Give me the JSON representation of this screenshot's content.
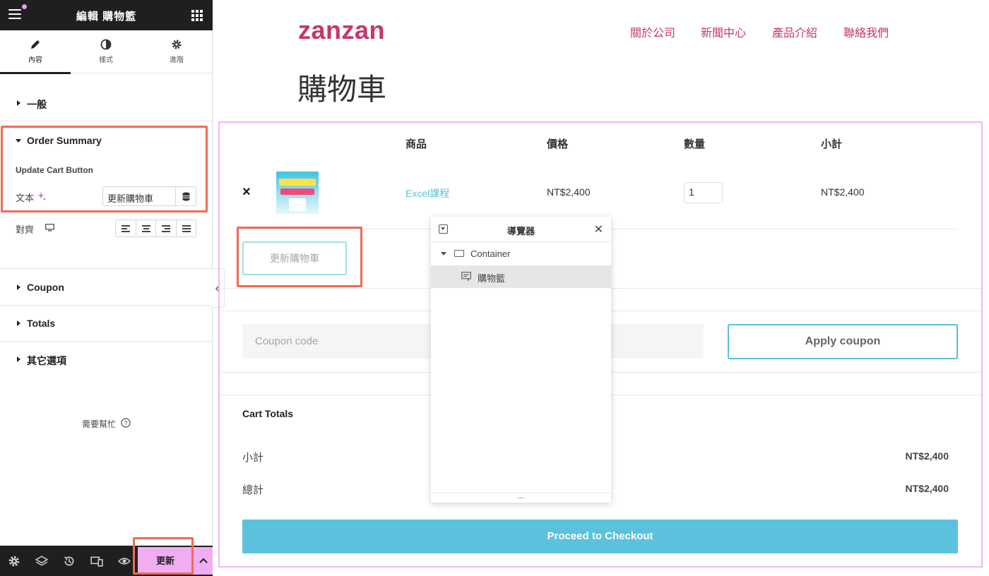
{
  "panel": {
    "title": "編輯 購物籃",
    "tabs": [
      {
        "label": "內容",
        "icon": "pencil-icon"
      },
      {
        "label": "樣式",
        "icon": "half-circle-icon"
      },
      {
        "label": "進階",
        "icon": "gear-icon"
      }
    ],
    "sections": {
      "general": "一般",
      "order_summary": "Order Summary",
      "coupon": "Coupon",
      "totals": "Totals",
      "other": "其它選項"
    },
    "update_cart_button_heading": "Update Cart Button",
    "text_label": "文本",
    "text_value": "更新購物車",
    "align_label": "對齊",
    "help": "需要幫忙"
  },
  "footer": {
    "update_label": "更新"
  },
  "site": {
    "logo": "zanzan",
    "nav": [
      "關於公司",
      "新聞中心",
      "產品介紹",
      "聯絡我們"
    ],
    "page_title": "購物車"
  },
  "cart": {
    "headers": {
      "product": "商品",
      "price": "價格",
      "quantity": "數量",
      "subtotal": "小計"
    },
    "item": {
      "remove": "×",
      "name": "Excel課程",
      "price": "NT$2,400",
      "quantity": "1",
      "subtotal": "NT$2,400"
    },
    "update_button": "更新購物車",
    "coupon_placeholder": "Coupon code",
    "apply_coupon": "Apply coupon",
    "totals_title": "Cart Totals",
    "subtotal_label": "小計",
    "subtotal_value": "NT$2,400",
    "total_label": "總計",
    "total_value": "NT$2,400",
    "checkout": "Proceed to Checkout"
  },
  "navigator": {
    "title": "導覽器",
    "items": [
      "Container",
      "購物籃"
    ],
    "more": "..."
  },
  "colors": {
    "brand": "#c7356f",
    "accent": "#5bc1dd",
    "highlight": "#ee6b55",
    "editor_pink": "#f0adf2"
  }
}
